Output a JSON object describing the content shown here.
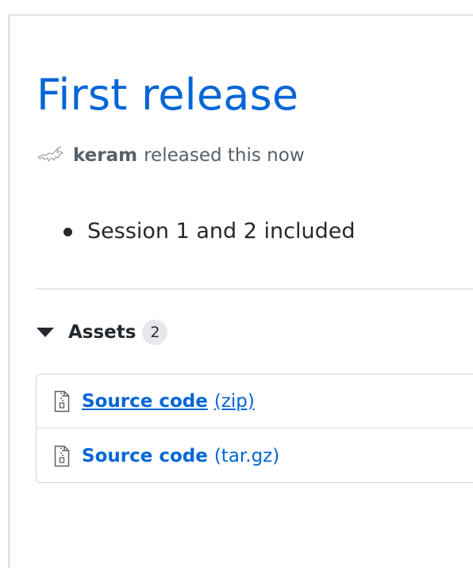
{
  "release": {
    "title": "First release",
    "author": "keram",
    "released_text": "released this now",
    "notes": [
      "Session 1 and 2 included"
    ]
  },
  "assets": {
    "label": "Assets",
    "count": "2",
    "items": [
      {
        "name": "Source code",
        "ext": "(zip)"
      },
      {
        "name": "Source code",
        "ext": "(tar.gz)"
      }
    ]
  },
  "colors": {
    "link": "#0366d6",
    "text": "#24292e",
    "muted": "#586069",
    "border": "#e1e4e8"
  },
  "icons": {
    "avatar": "unicorn-avatar-icon",
    "file": "file-zip-icon",
    "toggle": "triangle-down-icon"
  }
}
